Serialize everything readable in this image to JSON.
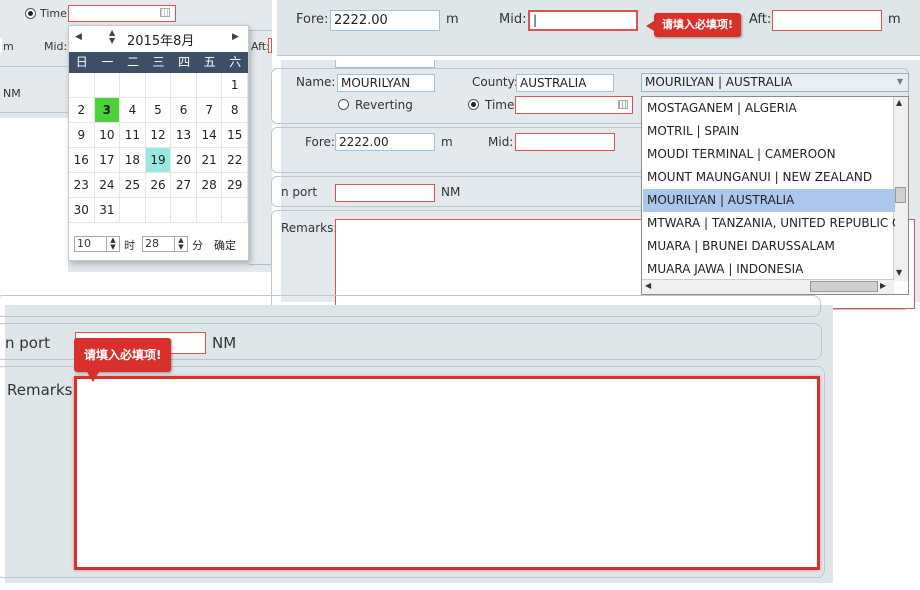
{
  "panel1": {
    "time_label": "Time:",
    "left_cut_labels": [
      "m",
      "Mid:",
      "NM"
    ],
    "aft_cut": "Aft:",
    "calendar": {
      "prev": "◀",
      "next": "▶",
      "updown": "▲▼",
      "title": "2015年8月",
      "weekdays": [
        "日",
        "一",
        "二",
        "三",
        "四",
        "五",
        "六"
      ],
      "rows": [
        [
          "",
          "",
          "",
          "",
          "",
          "",
          "1"
        ],
        [
          "2",
          "3",
          "4",
          "5",
          "6",
          "7",
          "8"
        ],
        [
          "9",
          "10",
          "11",
          "12",
          "13",
          "14",
          "15"
        ],
        [
          "16",
          "17",
          "18",
          "19",
          "20",
          "21",
          "22"
        ],
        [
          "23",
          "24",
          "25",
          "26",
          "27",
          "28",
          "29"
        ],
        [
          "30",
          "31",
          "",
          "",
          "",
          "",
          ""
        ]
      ],
      "today": "3",
      "selected": "19",
      "hour_value": "10",
      "hour_label": "时",
      "minute_value": "28",
      "minute_label": "分",
      "confirm": "确定"
    }
  },
  "panel2": {
    "fore_label": "Fore:",
    "fore_value": "2222.00",
    "m1": "m",
    "mid_label": "Mid:",
    "mid_value": "|",
    "tooltip": "请填入必填项!",
    "aft_label": "Aft:",
    "m2": "m",
    "name_label": "Name:",
    "name_value": "MOURILYAN",
    "county_label": "County:",
    "county_value": "AUSTRALIA",
    "port_select": "MOURILYAN | AUSTRALIA",
    "reverting_label": "Reverting",
    "time_label": "Time:",
    "fore2_label": "Fore:",
    "fore2_value": "2222.00",
    "m3": "m",
    "mid2_label": "Mid:",
    "port_cut": "n port",
    "nm_label": "NM",
    "remarks_label": "Remarks:",
    "dropdown_items": [
      "MOSTAGANEM | ALGERIA",
      "MOTRIL | SPAIN",
      "MOUDI TERMINAL | CAMEROON",
      "MOUNT MAUNGANUI | NEW ZEALAND",
      "MOURILYAN | AUSTRALIA",
      "MTWARA | TANZANIA, UNITED REPUBLIC OF",
      "MUARA | BRUNEI DARUSSALAM",
      "MUARA JAWA | INDONESIA"
    ],
    "dropdown_selected_index": 4
  },
  "panel3": {
    "port_cut": "n port",
    "nm_label": "NM",
    "tooltip": "请填入必填项!",
    "remarks_label": "Remarks:"
  },
  "colors": {
    "required_border": "#d9534f",
    "tooltip_bg": "#d9302c",
    "calendar_header": "#3d4f66",
    "today": "#4cd13a",
    "selected_day": "#9be6e0",
    "selected_option": "#a9c8ec"
  }
}
